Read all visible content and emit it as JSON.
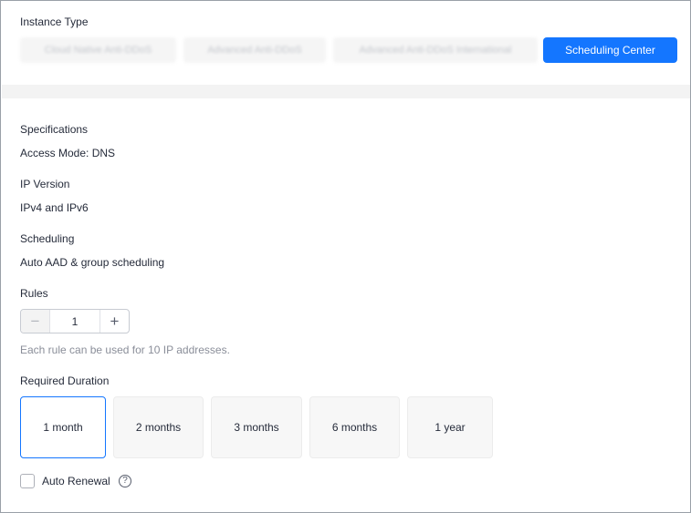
{
  "instance_type": {
    "label": "Instance Type",
    "tabs": [
      {
        "label": "Cloud Native Anti-DDoS",
        "active": false
      },
      {
        "label": "Advanced Anti-DDoS",
        "active": false
      },
      {
        "label": "Advanced Anti-DDoS International",
        "active": false
      },
      {
        "label": "Scheduling Center",
        "active": true
      }
    ]
  },
  "specifications": {
    "label": "Specifications",
    "access_mode": "Access Mode: DNS"
  },
  "ip_version": {
    "label": "IP Version",
    "value": "IPv4 and IPv6"
  },
  "scheduling": {
    "label": "Scheduling",
    "value": "Auto AAD & group scheduling"
  },
  "rules": {
    "label": "Rules",
    "value": "1",
    "minus_symbol": "−",
    "plus_symbol": "+",
    "hint": "Each rule can be used for 10 IP addresses."
  },
  "duration": {
    "label": "Required Duration",
    "options": [
      {
        "label": "1 month",
        "active": true
      },
      {
        "label": "2 months",
        "active": false
      },
      {
        "label": "3 months",
        "active": false
      },
      {
        "label": "6 months",
        "active": false
      },
      {
        "label": "1 year",
        "active": false
      }
    ]
  },
  "auto_renewal": {
    "label": "Auto Renewal",
    "checked": false,
    "help_symbol": "?"
  },
  "colors": {
    "accent": "#1476ff",
    "text": "#252b3a",
    "muted": "#8a8e99"
  }
}
